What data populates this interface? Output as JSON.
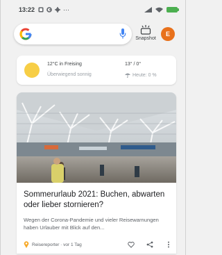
{
  "status_bar": {
    "time": "13:22",
    "left_icons": [
      "notification-icon",
      "google-icon",
      "settings-icon",
      "more-icon"
    ],
    "more_glyph": "···",
    "right_icons": [
      "signal-icon",
      "wifi-icon",
      "battery-icon"
    ]
  },
  "search": {
    "logo": "google-logo-icon",
    "mic": "mic-icon",
    "snapshot_label": "Snapshot",
    "avatar_initial": "E",
    "avatar_color": "#e8711c"
  },
  "weather": {
    "temp_location": "12°C in Freising",
    "condition": "Überwiegend sonnig",
    "range": "13° / 0°",
    "rain": "Heute: 0 %",
    "icon": "sun-icon"
  },
  "news": {
    "title": "Sommerurlaub 2021: Buchen, abwarten oder lieber stornieren?",
    "snippet": "Wegen der Corona-Pandemie und vieler Reisewarnungen haben Urlauber mit Blick auf den...",
    "source": "Reisereporter · vor 1 Tag",
    "actions": [
      "heart-icon",
      "share-icon",
      "more-vert-icon"
    ]
  }
}
